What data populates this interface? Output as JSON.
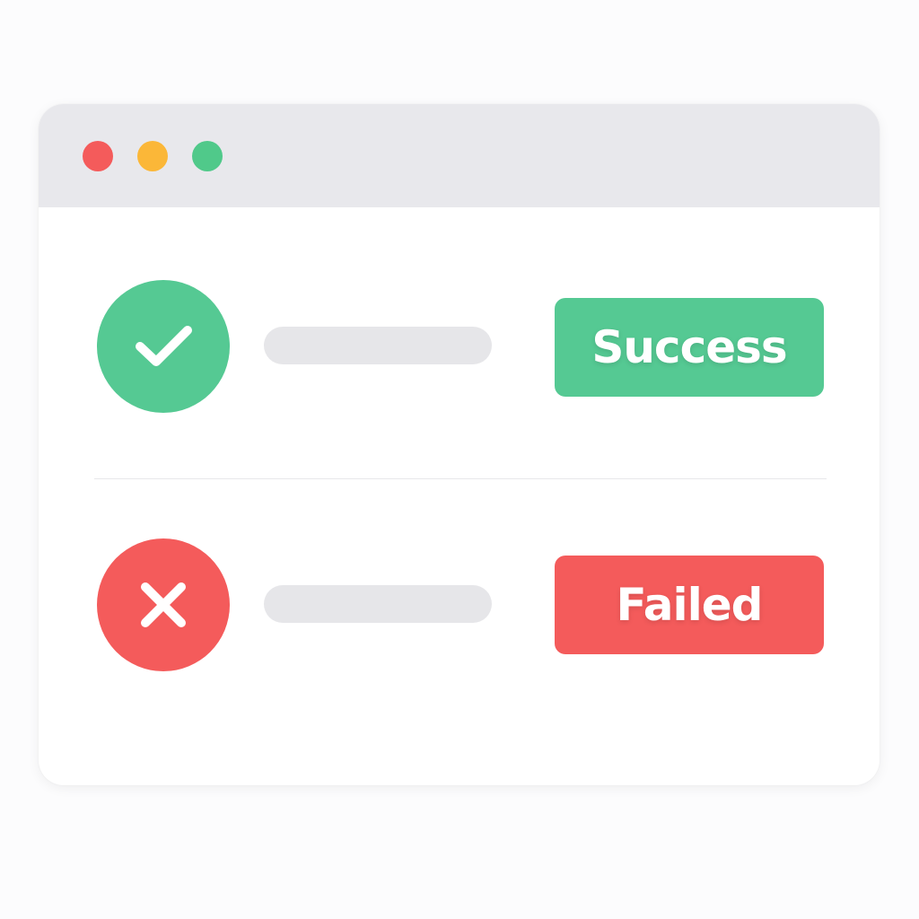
{
  "window": {
    "controls": [
      {
        "name": "close",
        "color": "#f45b5b"
      },
      {
        "name": "minimize",
        "color": "#fbb738"
      },
      {
        "name": "maximize",
        "color": "#50c98a"
      }
    ]
  },
  "rows": [
    {
      "status": "success",
      "icon": "checkmark-icon",
      "badge_label": "Success",
      "color": "#55c993"
    },
    {
      "status": "failed",
      "icon": "x-icon",
      "badge_label": "Failed",
      "color": "#f45b5b"
    }
  ],
  "colors": {
    "titlebar": "#e8e8ec",
    "placeholder": "#e6e6e9",
    "window": "#ffffff"
  }
}
